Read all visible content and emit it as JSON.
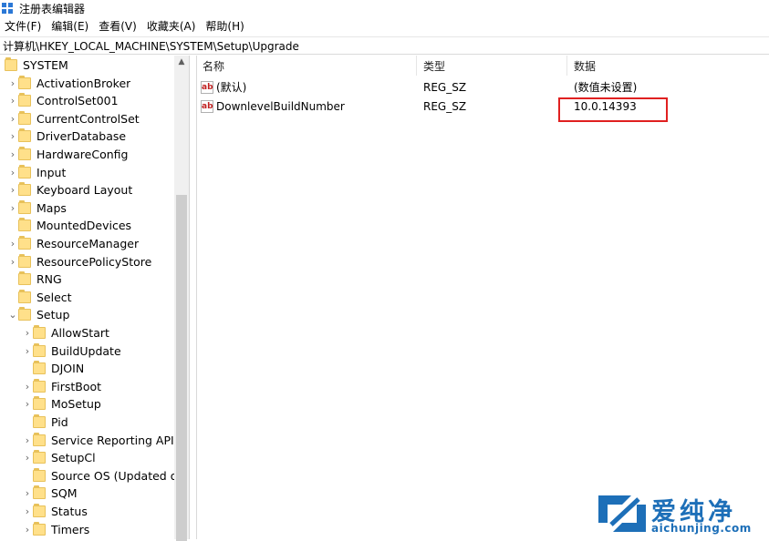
{
  "window": {
    "title": "注册表编辑器"
  },
  "menu": [
    "文件(F)",
    "编辑(E)",
    "查看(V)",
    "收藏夹(A)",
    "帮助(H)"
  ],
  "address": "计算机\\HKEY_LOCAL_MACHINE\\SYSTEM\\Setup\\Upgrade",
  "tree": [
    {
      "label": "SYSTEM",
      "depth": 0,
      "chevron": ""
    },
    {
      "label": "ActivationBroker",
      "depth": 1,
      "chevron": "›"
    },
    {
      "label": "ControlSet001",
      "depth": 1,
      "chevron": "›"
    },
    {
      "label": "CurrentControlSet",
      "depth": 1,
      "chevron": "›"
    },
    {
      "label": "DriverDatabase",
      "depth": 1,
      "chevron": "›"
    },
    {
      "label": "HardwareConfig",
      "depth": 1,
      "chevron": "›"
    },
    {
      "label": "Input",
      "depth": 1,
      "chevron": "›"
    },
    {
      "label": "Keyboard Layout",
      "depth": 1,
      "chevron": "›"
    },
    {
      "label": "Maps",
      "depth": 1,
      "chevron": "›"
    },
    {
      "label": "MountedDevices",
      "depth": 1,
      "chevron": ""
    },
    {
      "label": "ResourceManager",
      "depth": 1,
      "chevron": "›"
    },
    {
      "label": "ResourcePolicyStore",
      "depth": 1,
      "chevron": "›"
    },
    {
      "label": "RNG",
      "depth": 1,
      "chevron": ""
    },
    {
      "label": "Select",
      "depth": 1,
      "chevron": ""
    },
    {
      "label": "Setup",
      "depth": 1,
      "chevron": "⌄"
    },
    {
      "label": "AllowStart",
      "depth": 2,
      "chevron": "›"
    },
    {
      "label": "BuildUpdate",
      "depth": 2,
      "chevron": "›"
    },
    {
      "label": "DJOIN",
      "depth": 2,
      "chevron": ""
    },
    {
      "label": "FirstBoot",
      "depth": 2,
      "chevron": "›"
    },
    {
      "label": "MoSetup",
      "depth": 2,
      "chevron": "›"
    },
    {
      "label": "Pid",
      "depth": 2,
      "chevron": ""
    },
    {
      "label": "Service Reporting API",
      "depth": 2,
      "chevron": "›"
    },
    {
      "label": "SetupCl",
      "depth": 2,
      "chevron": "›"
    },
    {
      "label": "Source OS (Updated on",
      "depth": 2,
      "chevron": ""
    },
    {
      "label": "SQM",
      "depth": 2,
      "chevron": "›"
    },
    {
      "label": "Status",
      "depth": 2,
      "chevron": "›"
    },
    {
      "label": "Timers",
      "depth": 2,
      "chevron": "›"
    }
  ],
  "columns": {
    "name": "名称",
    "type": "类型",
    "data": "数据"
  },
  "values": [
    {
      "name": "(默认)",
      "type": "REG_SZ",
      "data": "(数值未设置)",
      "icon": "ab-string-icon"
    },
    {
      "name": "DownlevelBuildNumber",
      "type": "REG_SZ",
      "data": "10.0.14393",
      "icon": "ab-string-icon"
    }
  ],
  "watermark": {
    "text": "爱纯净",
    "url": "aichunjing.com"
  },
  "colors": {
    "highlight": "#e02020",
    "folder": "#ffe08a",
    "brand": "#1d6fb8"
  }
}
